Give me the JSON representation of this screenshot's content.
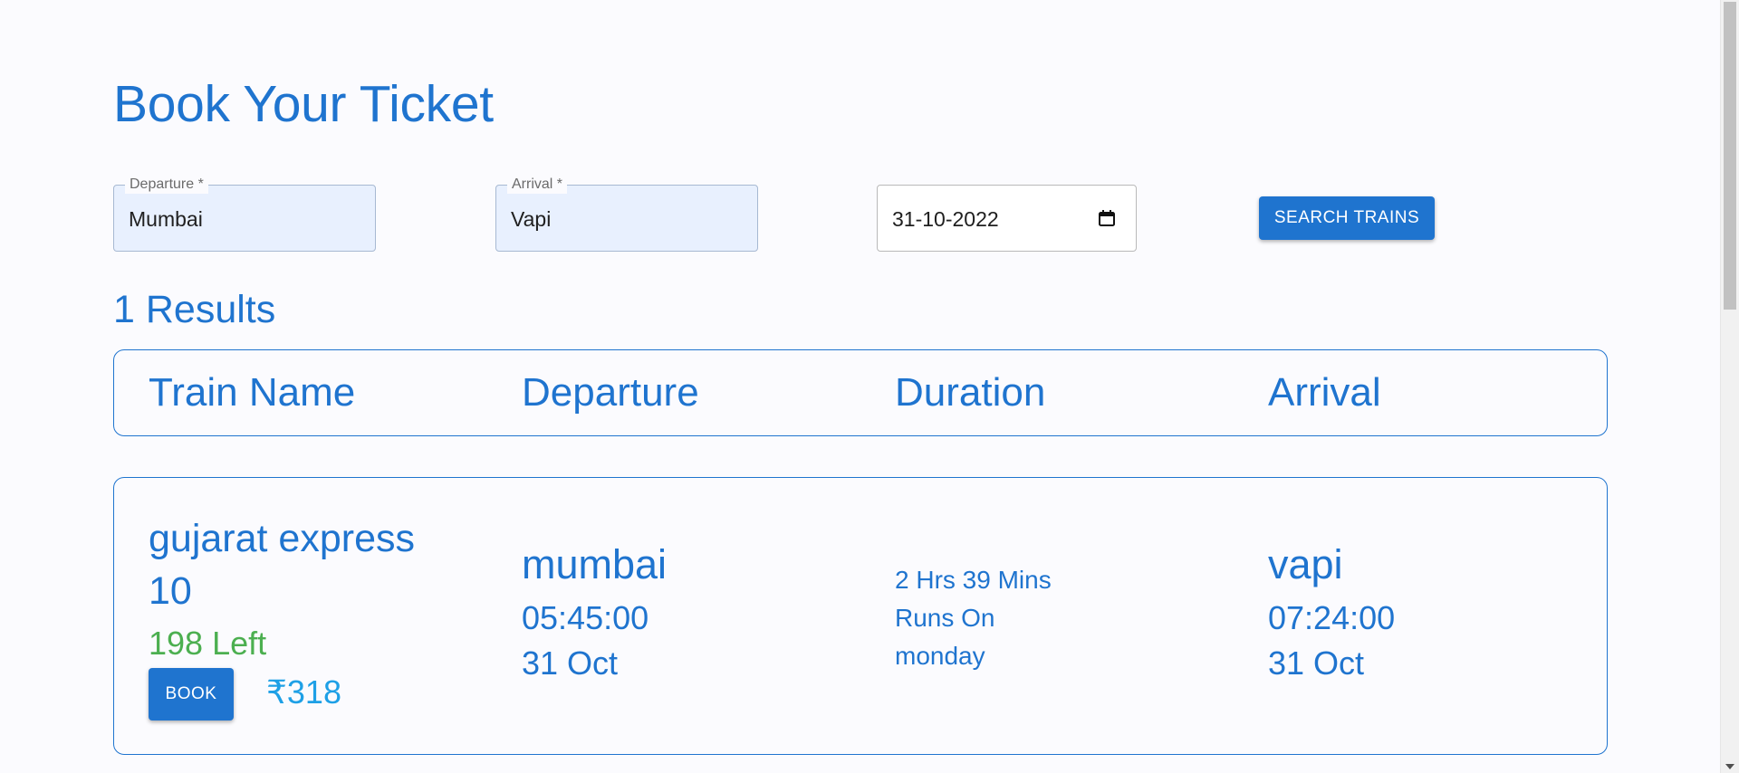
{
  "page": {
    "title": "Book Your Ticket"
  },
  "search": {
    "departure": {
      "label": "Departure *",
      "value": "Mumbai"
    },
    "arrival": {
      "label": "Arrival *",
      "value": "Vapi"
    },
    "date": {
      "value": "31-10-2022",
      "icon": "calendar-icon"
    },
    "search_button_label": "SEARCH TRAINS"
  },
  "results": {
    "count_text": "1 Results",
    "columns": [
      "Train Name",
      "Departure",
      "Duration",
      "Arrival"
    ],
    "items": [
      {
        "train_name": "gujarat express 10",
        "seats_left": "198 Left",
        "book_label": "BOOK",
        "price": "₹318",
        "departure_station": "mumbai",
        "departure_time": "05:45:00",
        "departure_date": "31 Oct",
        "duration": "2 Hrs 39 Mins",
        "runs_on_label": "Runs On",
        "runs_on_day": "monday",
        "arrival_station": "vapi",
        "arrival_time": "07:24:00",
        "arrival_date": "31 Oct"
      }
    ]
  },
  "colors": {
    "accent": "#1f74cf",
    "seats": "#4caf50",
    "price": "#1ea0e6",
    "field_fill": "#e8f0fe"
  }
}
